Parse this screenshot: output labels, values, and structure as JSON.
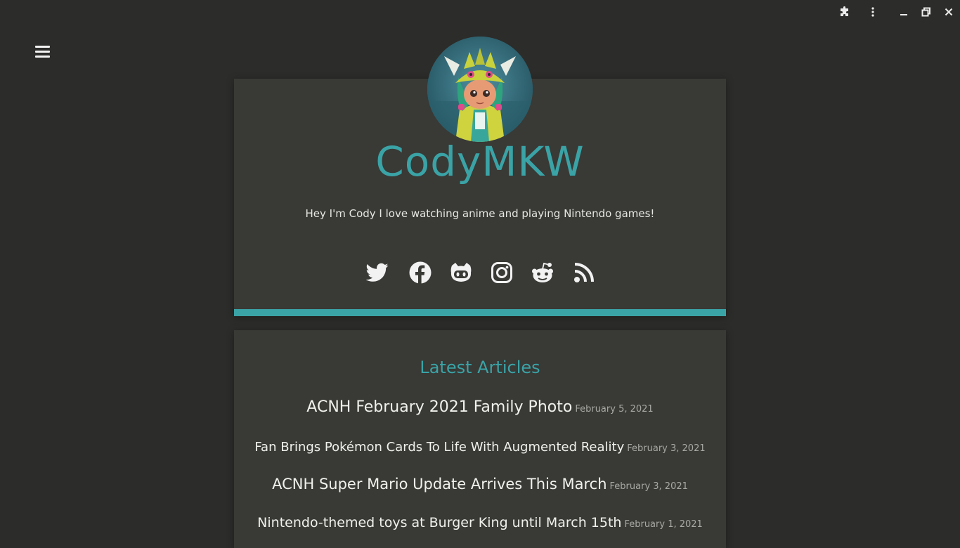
{
  "site": {
    "title": "CodyMKW",
    "bio": "Hey I'm Cody I love watching anime and playing Nintendo games!"
  },
  "colors": {
    "accent": "#3aa3a6",
    "background": "#2c2c2a",
    "card": "#393936",
    "text": "#f0f0ec",
    "muted": "#a8a8a4"
  },
  "window_controls": {
    "icons": [
      "puzzle-piece-icon",
      "more-vertical-icon",
      "minimize-icon",
      "restore-icon",
      "close-icon"
    ]
  },
  "menu": {
    "icon": "hamburger-menu-icon"
  },
  "socials": [
    {
      "name": "Twitter",
      "icon": "twitter-icon"
    },
    {
      "name": "Facebook",
      "icon": "facebook-icon"
    },
    {
      "name": "GitHub",
      "icon": "github-icon"
    },
    {
      "name": "Instagram",
      "icon": "instagram-icon"
    },
    {
      "name": "Reddit",
      "icon": "reddit-icon"
    },
    {
      "name": "RSS",
      "icon": "rss-icon"
    }
  ],
  "articles": {
    "heading": "Latest Articles",
    "items": [
      {
        "title": "ACNH February 2021 Family Photo",
        "date": "February 5, 2021"
      },
      {
        "title": "Fan Brings Pokémon Cards To Life With Augmented Reality",
        "date": "February 3, 2021"
      },
      {
        "title": "ACNH Super Mario Update Arrives This March",
        "date": "February 3, 2021"
      },
      {
        "title": "Nintendo-themed toys at Burger King until March 15th",
        "date": "February 1, 2021"
      }
    ]
  }
}
